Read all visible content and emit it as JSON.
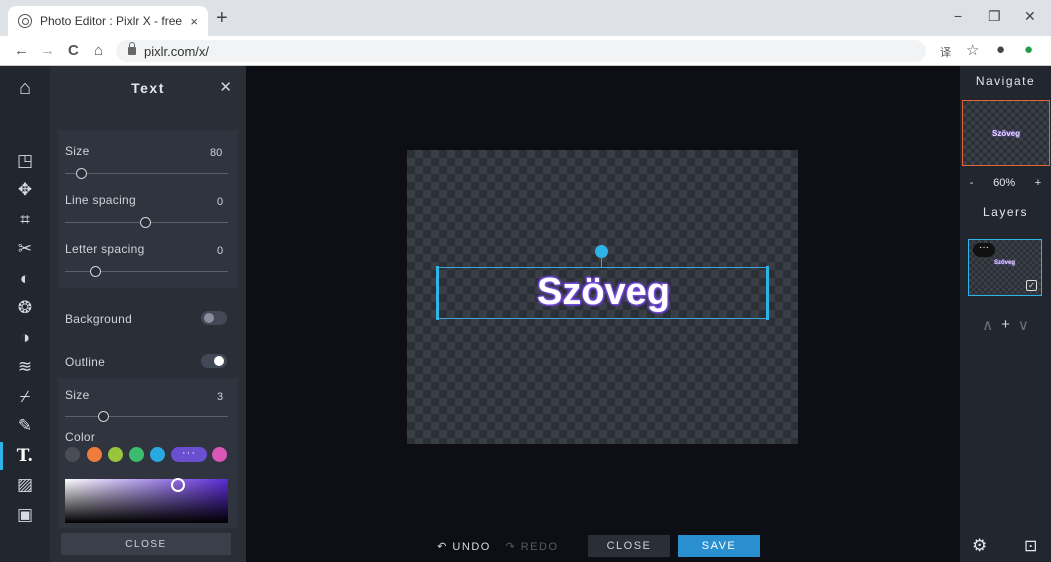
{
  "browser": {
    "tab_title": "Photo Editor : Pixlr X - free image",
    "tab_close": "×",
    "new_tab": "+",
    "minimize": "−",
    "restore": "❐",
    "close": "✕",
    "back": "←",
    "forward": "→",
    "reload": "C",
    "home": "⌂",
    "url": "pixlr.com/x/",
    "translate_icon": "译",
    "star_icon": "☆",
    "profile_icon": "●",
    "extension_icon": "●"
  },
  "toolbar": {
    "home_icon": "⌂",
    "tools": [
      {
        "name": "arrange-icon",
        "glyph": "◳"
      },
      {
        "name": "move-icon",
        "glyph": "✥"
      },
      {
        "name": "crop-icon",
        "glyph": "⌗"
      },
      {
        "name": "cutout-icon",
        "glyph": "✂"
      },
      {
        "name": "adjust-icon",
        "glyph": "◐"
      },
      {
        "name": "filter-icon",
        "glyph": "❂"
      },
      {
        "name": "effect-icon",
        "glyph": "◑"
      },
      {
        "name": "liquify-icon",
        "glyph": "≋"
      },
      {
        "name": "retouch-icon",
        "glyph": "⌿"
      },
      {
        "name": "draw-icon",
        "glyph": "✎"
      },
      {
        "name": "text-icon",
        "glyph": "T."
      },
      {
        "name": "element-icon",
        "glyph": "▨"
      },
      {
        "name": "add-image-icon",
        "glyph": "▣"
      }
    ]
  },
  "text_panel": {
    "title": "Text",
    "close_icon": "✕",
    "size_label": "Size",
    "size_value": "80",
    "line_spacing_label": "Line spacing",
    "line_spacing_value": "0",
    "letter_spacing_label": "Letter spacing",
    "letter_spacing_value": "0",
    "background_label": "Background",
    "background_on": false,
    "outline_label": "Outline",
    "outline_on": true,
    "outline_size_label": "Size",
    "outline_size_value": "3",
    "color_label": "Color",
    "swatches": [
      "#4a4d55",
      "#f07c3c",
      "#9ac43c",
      "#3dbb6f",
      "#29a9e1",
      "more",
      "#d957b5"
    ],
    "more_label": "···",
    "close_button": "CLOSE"
  },
  "canvas": {
    "text": "Szöveg"
  },
  "bottom_bar": {
    "undo": "↶ UNDO",
    "redo": "↷ REDO",
    "close": "CLOSE",
    "save": "SAVE"
  },
  "right_panel": {
    "navigate_title": "Navigate",
    "thumb_text": "Szöveg",
    "zoom_out": "-",
    "zoom_level": "60%",
    "zoom_in": "+",
    "layers_title": "Layers",
    "layer_thumb_text": "Szöveg",
    "layer_more": "···",
    "layer_check": "✓",
    "move_up": "∧",
    "add_layer": "+",
    "move_down": "∨",
    "settings_icon": "⚙",
    "collapse_icon": "⊡"
  },
  "colors": {
    "accent": "#2fb4e9",
    "save_bg": "#2a8fce",
    "panel_bg": "#2a2e37",
    "workspace_bg": "#0e0f14"
  }
}
